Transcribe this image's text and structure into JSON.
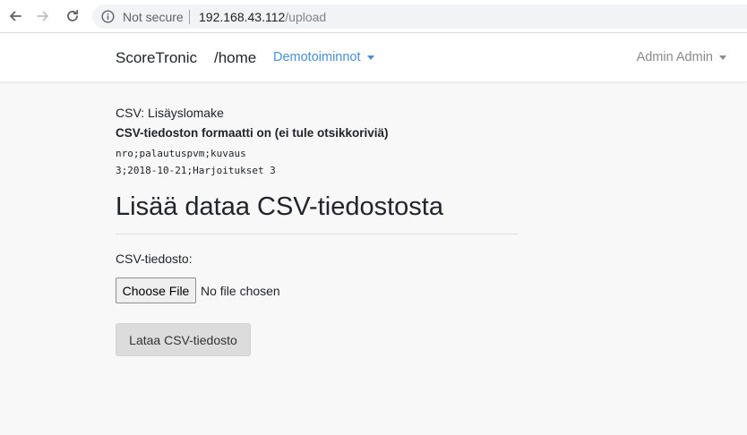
{
  "browser": {
    "security_label": "Not secure",
    "url_host": "192.168.43.112",
    "url_path": "/upload",
    "icons": [
      "back-arrow-icon",
      "forward-arrow-icon",
      "reload-icon",
      "info-icon"
    ]
  },
  "navbar": {
    "brand": "ScoreTronic",
    "home": "/home",
    "menu": "Demotoiminnot",
    "user": "Admin Admin",
    "colors": {
      "menu_link": "#4a8fd6",
      "user_link": "#8a8a8a"
    }
  },
  "form": {
    "title": "CSV: Lisäyslomake",
    "format_description": "CSV-tiedoston formaatti on (ei tule otsikkoriviä)",
    "format_header": "nro;palautuspvm;kuvaus",
    "format_example": "3;2018-10-21;Harjoitukset 3",
    "heading": "Lisää dataa CSV-tiedostosta",
    "file_label": "CSV-tiedosto:",
    "choose_file": "Choose File",
    "file_status": "No file chosen",
    "submit": "Lataa CSV-tiedosto"
  }
}
